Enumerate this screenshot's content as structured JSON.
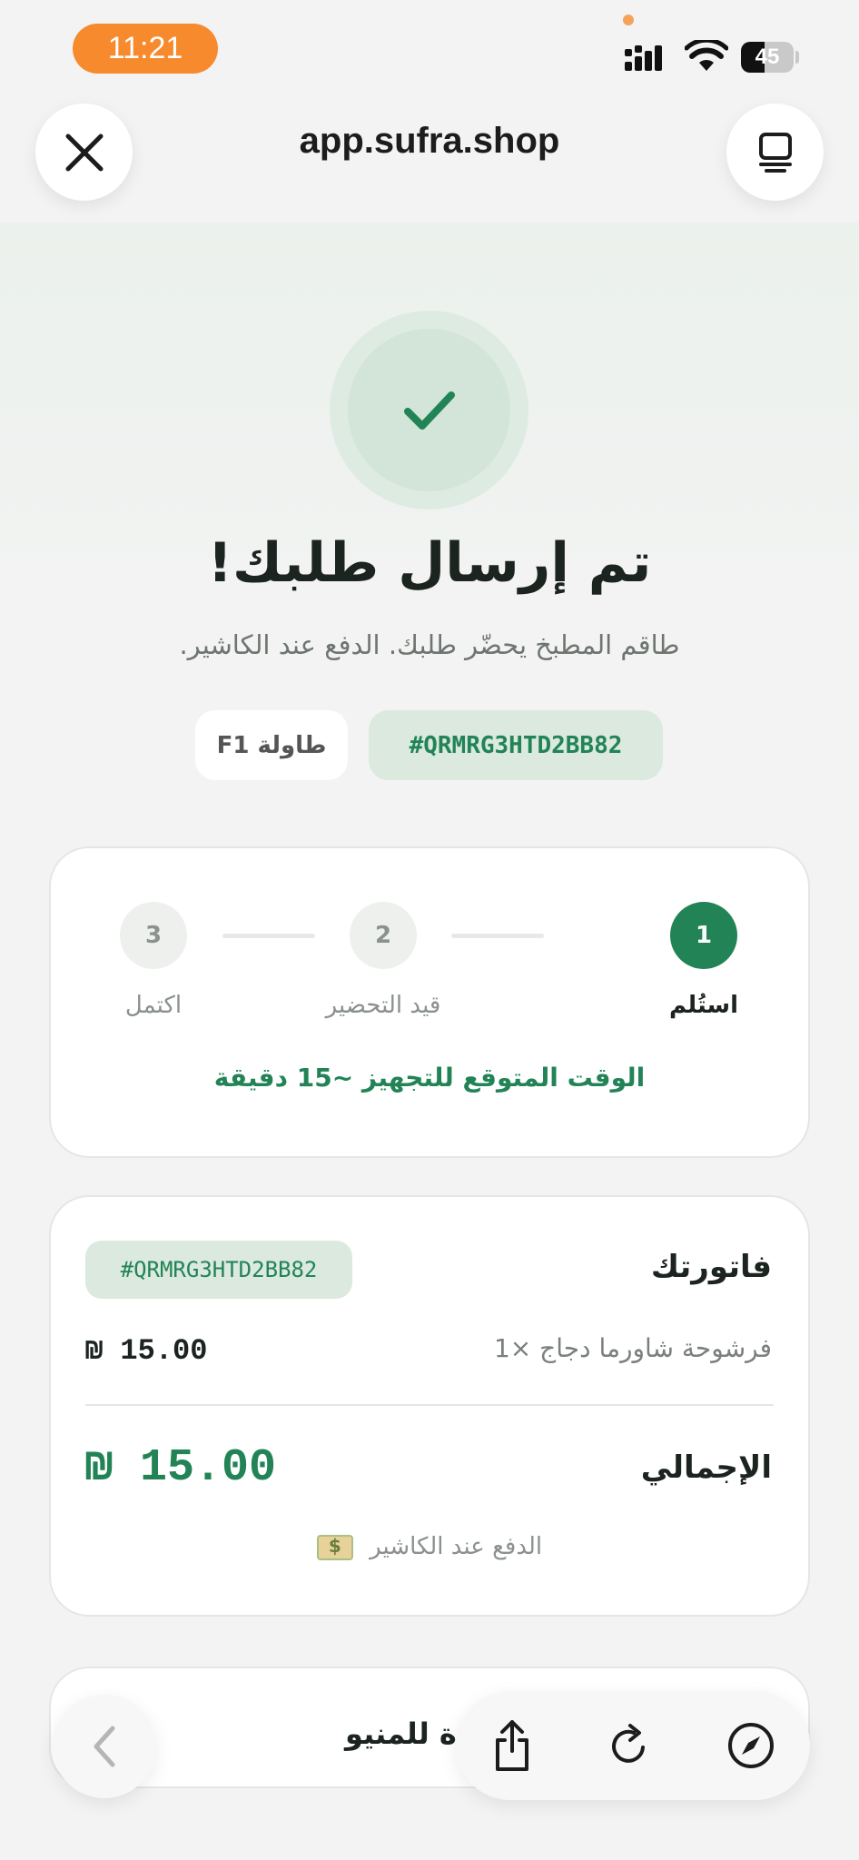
{
  "status_bar": {
    "time": "11:21",
    "battery": "45"
  },
  "browser": {
    "url": "app.sufra.shop"
  },
  "confirmation": {
    "title": "تم إرسال طلبك!",
    "subtitle": "طاقم المطبخ يحضّر طلبك. الدفع عند الكاشير.",
    "order_code": "#QRMRG3HTD2BB82",
    "table": "طاولة F1"
  },
  "progress": {
    "steps": [
      {
        "number": "1",
        "label": "استُلم",
        "active": true
      },
      {
        "number": "2",
        "label": "قيد التحضير",
        "active": false
      },
      {
        "number": "3",
        "label": "اكتمل",
        "active": false
      }
    ],
    "eta": "الوقت المتوقع للتجهيز ~15 دقيقة"
  },
  "invoice": {
    "title": "فاتورتك",
    "order_code": "#QRMRG3HTD2BB82",
    "items": [
      {
        "name": "فرشوحة شاورما دجاج ×1",
        "price": "₪ 15.00"
      }
    ],
    "total_label": "الإجمالي",
    "total_value": "₪ 15.00",
    "payment_note": "الدفع عند الكاشير"
  },
  "footer": {
    "back_to_menu": "دة للمنيو"
  },
  "colors": {
    "accent": "#228456",
    "status_pill": "#f68a2d"
  }
}
